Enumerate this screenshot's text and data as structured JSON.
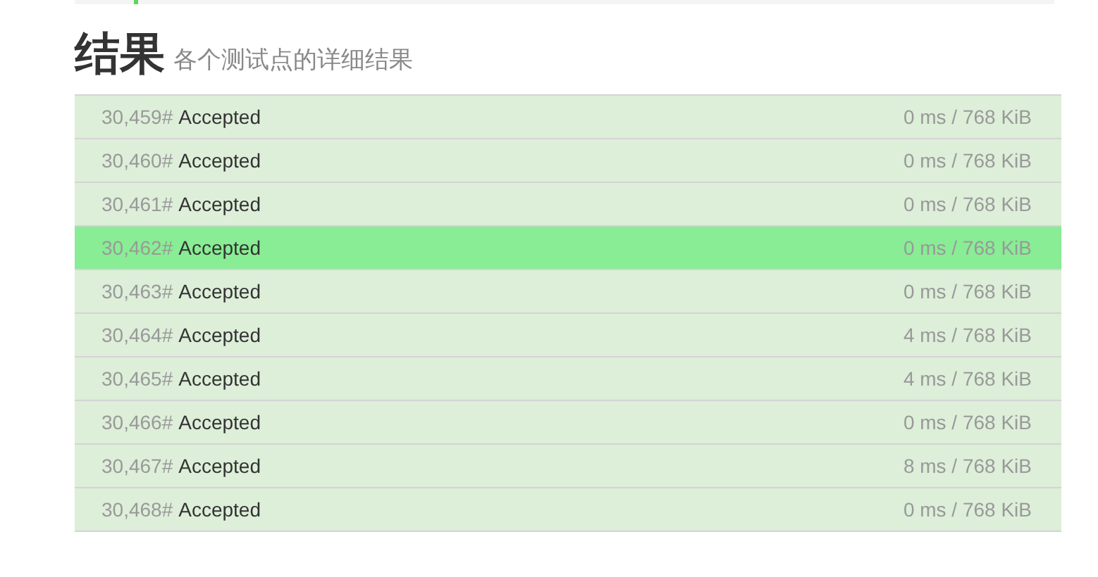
{
  "heading": {
    "title": "结果",
    "subtitle": "各个测试点的详细结果"
  },
  "rows": [
    {
      "id": "30,459#",
      "status": "Accepted",
      "usage": "0 ms / 768 KiB",
      "selected": false
    },
    {
      "id": "30,460#",
      "status": "Accepted",
      "usage": "0 ms / 768 KiB",
      "selected": false
    },
    {
      "id": "30,461#",
      "status": "Accepted",
      "usage": "0 ms / 768 KiB",
      "selected": false
    },
    {
      "id": "30,462#",
      "status": "Accepted",
      "usage": "0 ms / 768 KiB",
      "selected": true
    },
    {
      "id": "30,463#",
      "status": "Accepted",
      "usage": "0 ms / 768 KiB",
      "selected": false
    },
    {
      "id": "30,464#",
      "status": "Accepted",
      "usage": "4 ms / 768 KiB",
      "selected": false
    },
    {
      "id": "30,465#",
      "status": "Accepted",
      "usage": "4 ms / 768 KiB",
      "selected": false
    },
    {
      "id": "30,466#",
      "status": "Accepted",
      "usage": "0 ms / 768 KiB",
      "selected": false
    },
    {
      "id": "30,467#",
      "status": "Accepted",
      "usage": "8 ms / 768 KiB",
      "selected": false
    },
    {
      "id": "30,468#",
      "status": "Accepted",
      "usage": "0 ms / 768 KiB",
      "selected": false
    }
  ]
}
